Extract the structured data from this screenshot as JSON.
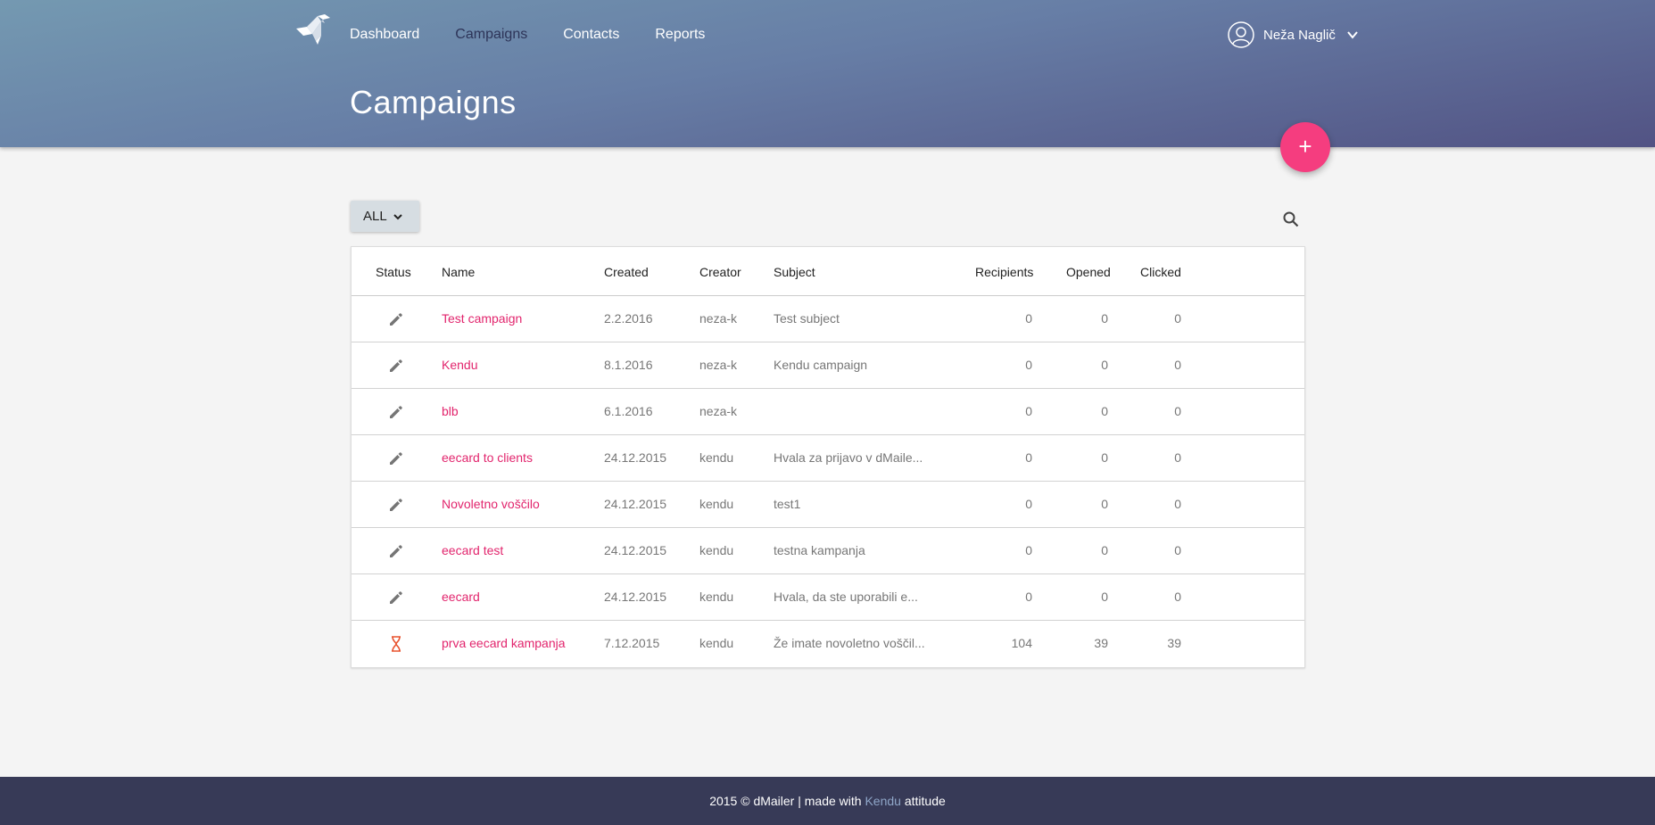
{
  "nav": {
    "items": [
      {
        "label": "Dashboard",
        "active": false
      },
      {
        "label": "Campaigns",
        "active": true
      },
      {
        "label": "Contacts",
        "active": false
      },
      {
        "label": "Reports",
        "active": false
      }
    ]
  },
  "user": {
    "name": "Neža Naglič",
    "icon": "user-circle-icon"
  },
  "page": {
    "title": "Campaigns"
  },
  "fab": {
    "label": "+"
  },
  "filter": {
    "selected": "ALL"
  },
  "table": {
    "headers": {
      "status": "Status",
      "name": "Name",
      "created": "Created",
      "creator": "Creator",
      "subject": "Subject",
      "recipients": "Recipients",
      "opened": "Opened",
      "clicked": "Clicked"
    },
    "rows": [
      {
        "status": "draft",
        "name": "Test campaign",
        "created": "2.2.2016",
        "creator": "neza-k",
        "subject": "Test subject",
        "recipients": "0",
        "opened": "0",
        "clicked": "0"
      },
      {
        "status": "draft",
        "name": "Kendu",
        "created": "8.1.2016",
        "creator": "neza-k",
        "subject": "Kendu campaign",
        "recipients": "0",
        "opened": "0",
        "clicked": "0"
      },
      {
        "status": "draft",
        "name": "blb",
        "created": "6.1.2016",
        "creator": "neza-k",
        "subject": "",
        "recipients": "0",
        "opened": "0",
        "clicked": "0"
      },
      {
        "status": "draft",
        "name": "eecard to clients",
        "created": "24.12.2015",
        "creator": "kendu",
        "subject": "Hvala za prijavo v dMaile...",
        "recipients": "0",
        "opened": "0",
        "clicked": "0"
      },
      {
        "status": "draft",
        "name": "Novoletno voščilo",
        "created": "24.12.2015",
        "creator": "kendu",
        "subject": "test1",
        "recipients": "0",
        "opened": "0",
        "clicked": "0"
      },
      {
        "status": "draft",
        "name": "eecard test",
        "created": "24.12.2015",
        "creator": "kendu",
        "subject": "testna kampanja",
        "recipients": "0",
        "opened": "0",
        "clicked": "0"
      },
      {
        "status": "draft",
        "name": "eecard",
        "created": "24.12.2015",
        "creator": "kendu",
        "subject": "Hvala, da ste uporabili e...",
        "recipients": "0",
        "opened": "0",
        "clicked": "0"
      },
      {
        "status": "scheduled",
        "name": "prva eecard kampanja",
        "created": "7.12.2015",
        "creator": "kendu",
        "subject": "Že imate novoletno voščil...",
        "recipients": "104",
        "opened": "39",
        "clicked": "39"
      }
    ]
  },
  "footer": {
    "prefix": "2015 © dMailer | made with ",
    "link": "Kendu",
    "suffix": " attitude"
  },
  "colors": {
    "accent": "#f53d7f",
    "link": "#e2256d",
    "footer": "#373a57",
    "scheduled_icon": "#e8532f"
  }
}
